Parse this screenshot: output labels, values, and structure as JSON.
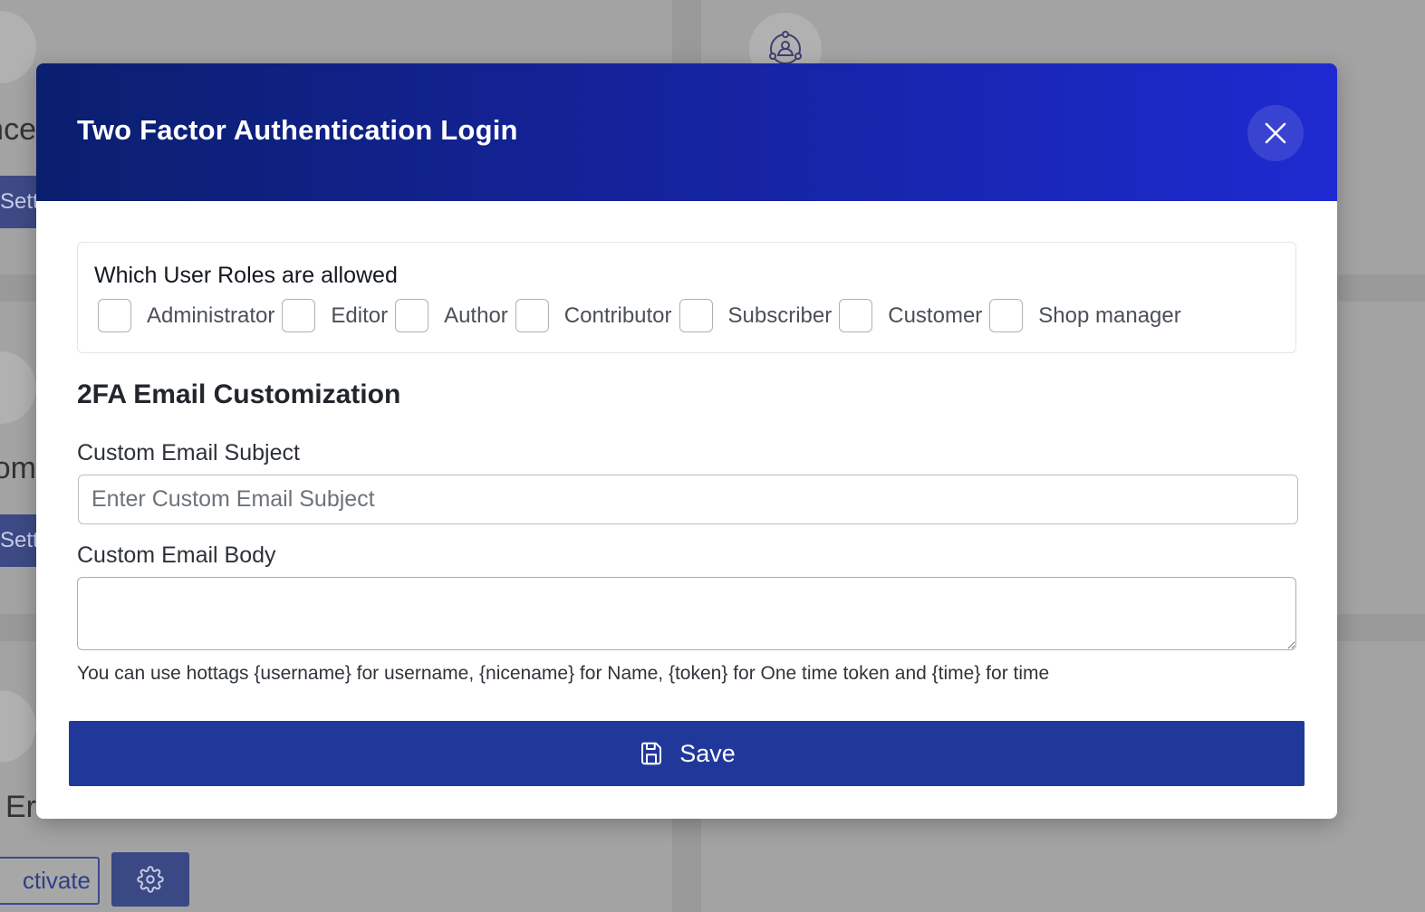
{
  "background": {
    "partial_texts": [
      "nce",
      "om",
      "n Er"
    ],
    "settings_button_label": "Sett",
    "activate_button_label": "ctivate"
  },
  "modal": {
    "title": "Two Factor Authentication Login",
    "close_icon": "close-icon",
    "roles": {
      "title": "Which User Roles are allowed",
      "items": [
        {
          "label": "Administrator",
          "checked": false
        },
        {
          "label": "Editor",
          "checked": false
        },
        {
          "label": "Author",
          "checked": false
        },
        {
          "label": "Contributor",
          "checked": false
        },
        {
          "label": "Subscriber",
          "checked": false
        },
        {
          "label": "Customer",
          "checked": false
        },
        {
          "label": "Shop manager",
          "checked": false
        }
      ]
    },
    "email_section": {
      "heading": "2FA Email Customization",
      "subject_label": "Custom Email Subject",
      "subject_placeholder": "Enter Custom Email Subject",
      "subject_value": "",
      "body_label": "Custom Email Body",
      "body_value": "",
      "hint": "You can use hottags {username} for username, {nicename} for Name, {token} for One time token and {time} for time"
    },
    "save_button": {
      "label": "Save",
      "icon": "save-icon"
    }
  },
  "colors": {
    "header_gradient_start": "#0a1f6e",
    "header_gradient_end": "#1e2ad0",
    "save_button": "#21389b",
    "overlay": "#a3a3a3"
  }
}
